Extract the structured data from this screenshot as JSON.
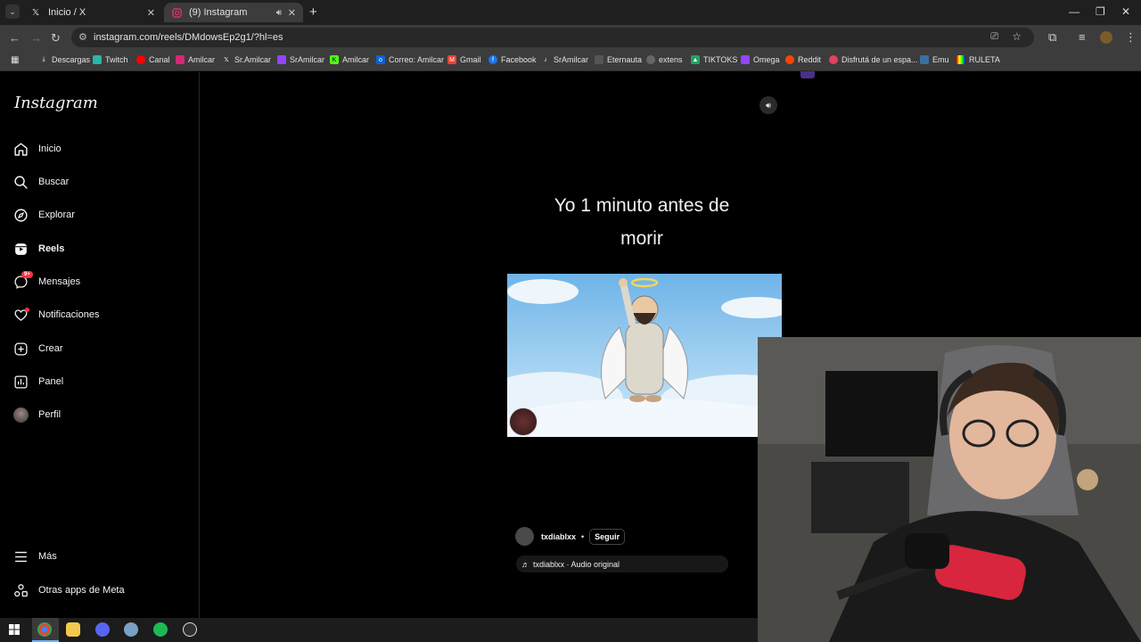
{
  "browser": {
    "tabs": [
      {
        "title": "Inicio / X",
        "icon": "x-logo-icon",
        "active": false
      },
      {
        "title": "(9) Instagram",
        "icon": "instagram-icon",
        "active": true
      }
    ],
    "url": "instagram.com/reels/DMdowsEp2g1/?hl=es",
    "bookmarks": [
      "Descargas",
      "Twitch",
      "Canal",
      "Amilcar",
      "Sr.Amilcar",
      "SrAmilcar",
      "Amilcar",
      "Correo: Amilcar",
      "Gmail",
      "Facebook",
      "SrAmilcar",
      "Eternauta",
      "extens",
      "TIKTOKS",
      "Omega",
      "Reddit",
      "Disfrutá de un espa...",
      "Emu",
      "RULETA"
    ]
  },
  "instagram": {
    "logo": "Instagram",
    "nav": [
      {
        "label": "Inicio",
        "icon": "home-icon"
      },
      {
        "label": "Buscar",
        "icon": "search-icon"
      },
      {
        "label": "Explorar",
        "icon": "compass-icon"
      },
      {
        "label": "Reels",
        "icon": "reels-icon"
      },
      {
        "label": "Mensajes",
        "icon": "messenger-icon",
        "badge": "9+"
      },
      {
        "label": "Notificaciones",
        "icon": "heart-icon"
      },
      {
        "label": "Crear",
        "icon": "plus-square-icon"
      },
      {
        "label": "Panel",
        "icon": "chart-icon"
      },
      {
        "label": "Perfil",
        "icon": "avatar"
      }
    ],
    "bottom_nav": [
      {
        "label": "Más",
        "icon": "menu-icon"
      },
      {
        "label": "Otras apps de Meta",
        "icon": "meta-apps-icon"
      }
    ]
  },
  "reel": {
    "caption_line1": "Yo 1 minuto antes de",
    "caption_line2": "morir",
    "author": "txdiablxx",
    "separator": "•",
    "follow_label": "Seguir",
    "audio": "txdiablxx · Audio original"
  },
  "colors": {
    "background": "#000000",
    "accent_badge": "#ff3040",
    "chrome_dark": "#3c3c3c"
  }
}
